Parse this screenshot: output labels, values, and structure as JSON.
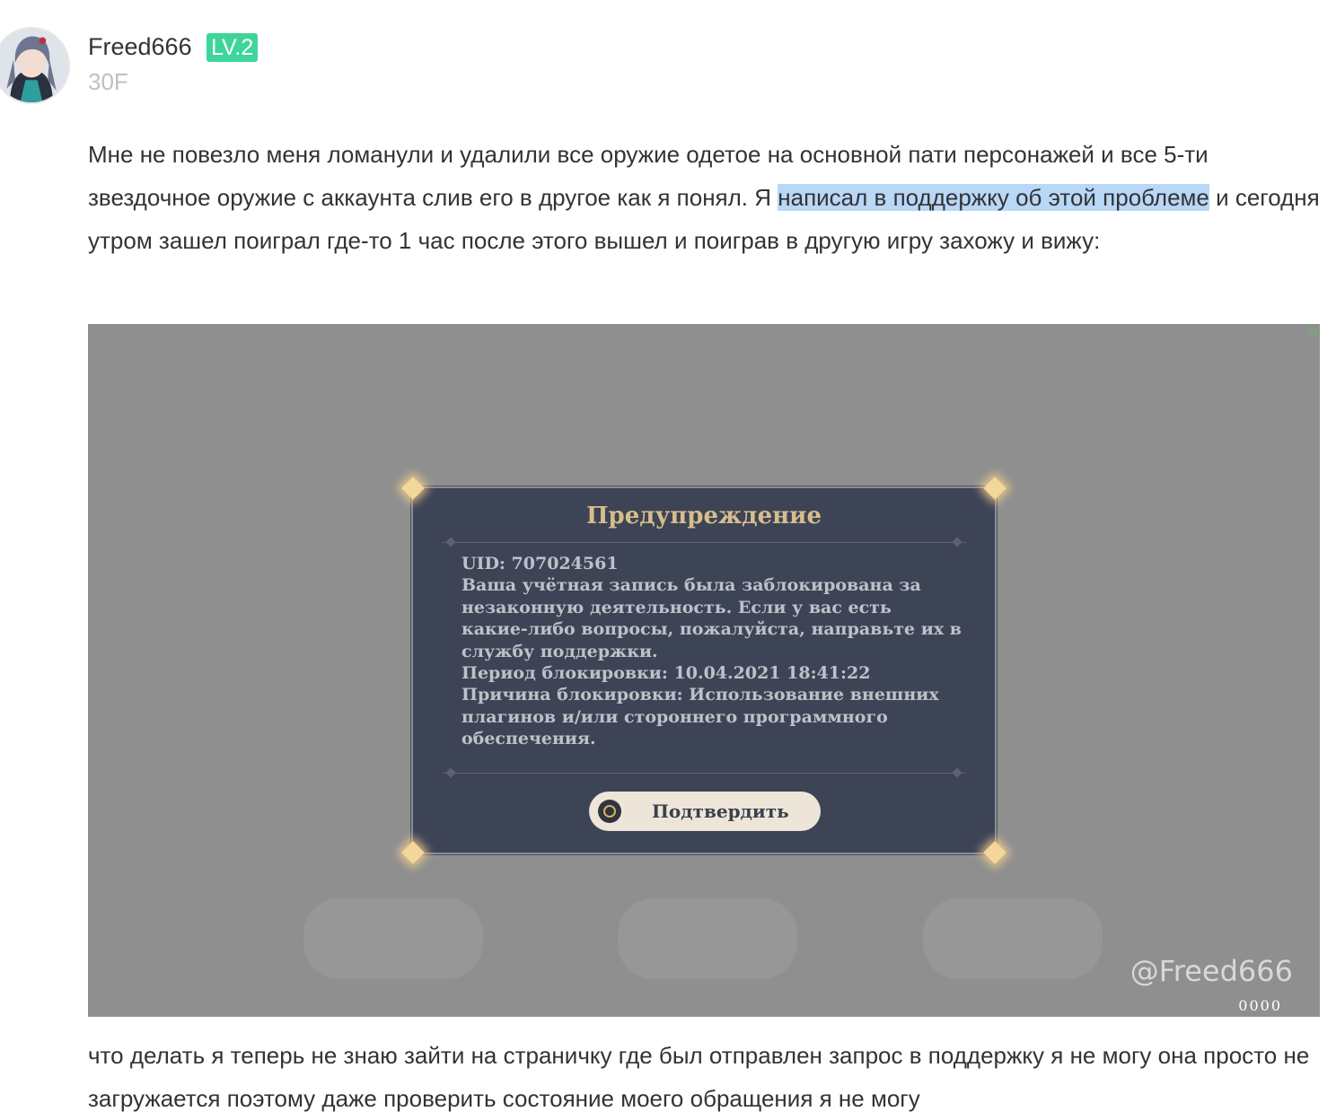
{
  "post": {
    "author": {
      "name": "Freed666",
      "level": "LV.2",
      "avatar_icon": "anime-avatar-icon"
    },
    "floor": "30F",
    "paragraph1": {
      "before_highlight": "Мне не повезло меня ломанули и удалили все оружие одетое на основной пати персонажей и все 5-ти звездочное оружие с аккаунта слив его в другое как я понял. Я ",
      "highlight": "написал в поддержку об этой проблеме",
      "after_highlight": " и сегодня утром зашел поиграл где-то 1 час после этого вышел и поиграв в другую игру захожу и вижу:"
    },
    "paragraph2": "что делать я теперь не знаю зайти на страничку где был отправлен запрос в поддержку я не могу она просто не загружается поэтому даже проверить состояние моего обращения я не могу",
    "highlight_color": "#b9d7f7",
    "level_badge_color": "#3ed59b"
  },
  "screenshot": {
    "fps_counter": "60",
    "dialog": {
      "title": "Предупреждение",
      "lines": [
        "UID: 707024561",
        "Ваша учётная запись была заблокирована за",
        "незаконную деятельность. Если у вас есть",
        "какие-либо вопросы, пожалуйста, направьте их в",
        "службу поддержки.",
        "Период блокировки: 10.04.2021 18:41:22",
        "Причина блокировки: Использование внешних",
        "плагинов и/или стороннего программного",
        "обеспечения."
      ],
      "confirm_label": "Подтвердить",
      "confirm_icon": "circle-button-icon"
    },
    "watermark": "@Freed666",
    "watermark_sub": "0000"
  }
}
